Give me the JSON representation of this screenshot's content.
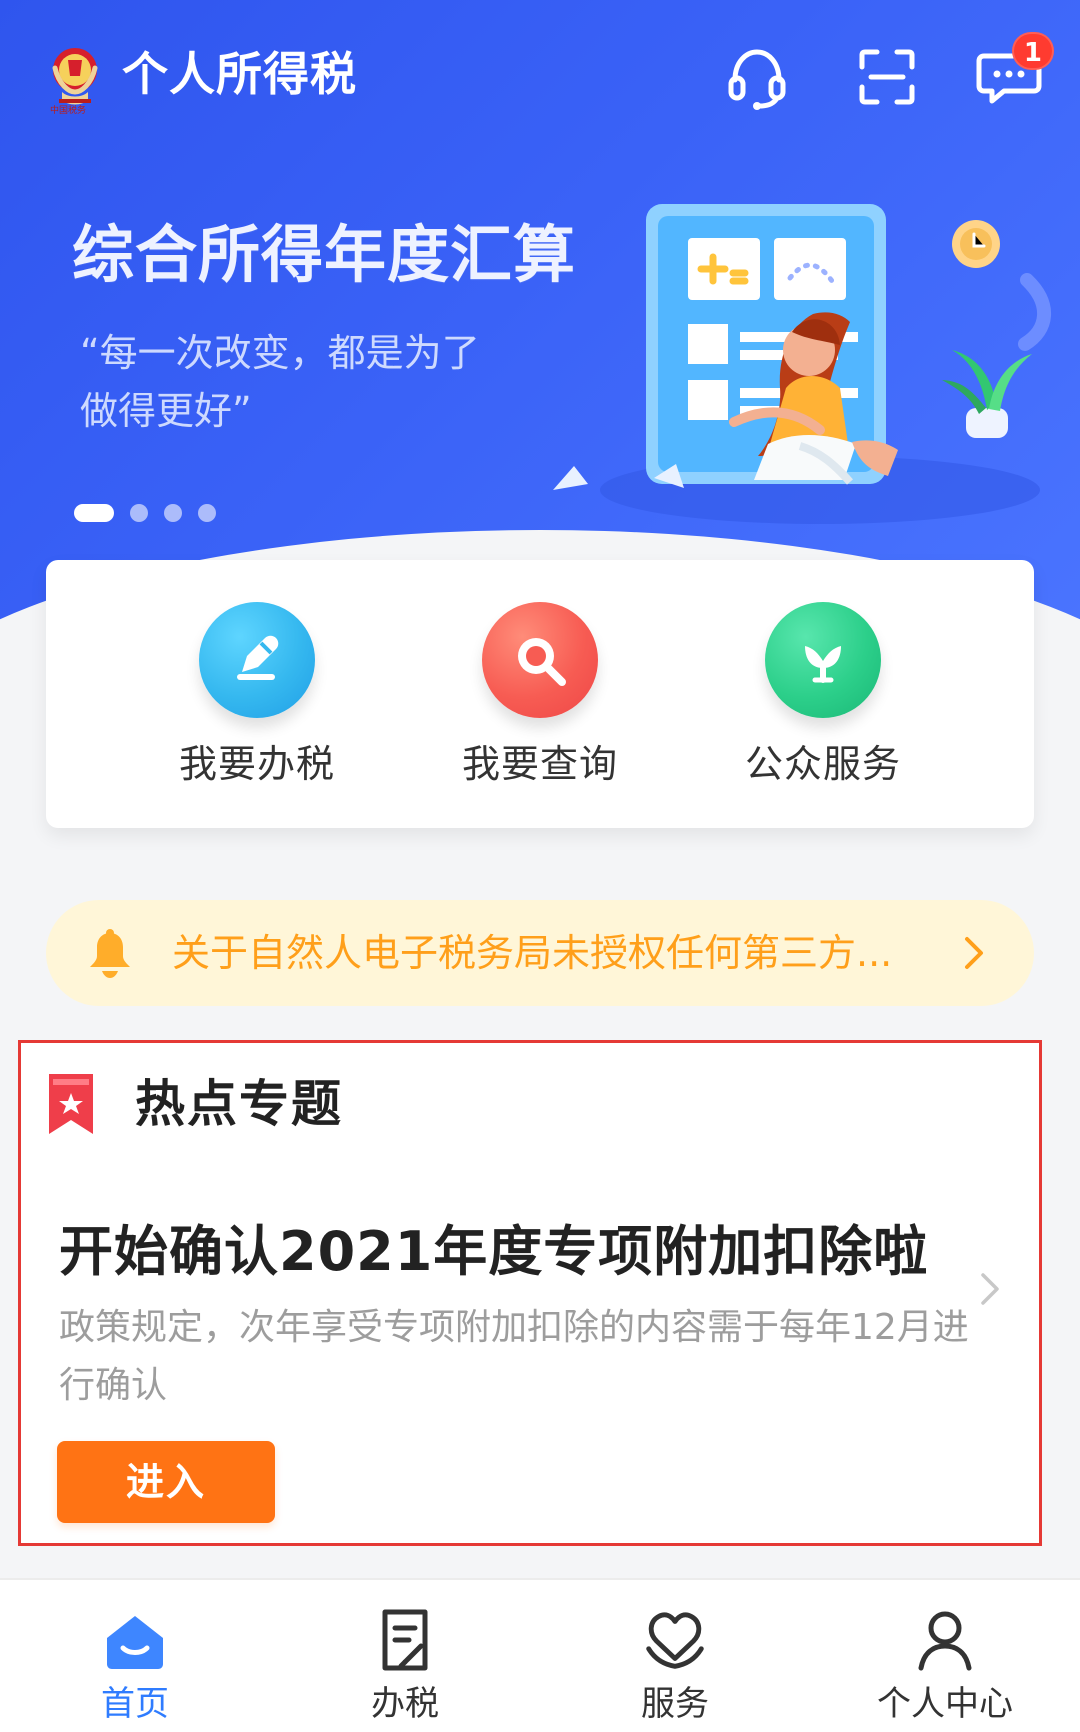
{
  "header": {
    "title": "个人所得税",
    "message_badge": "1"
  },
  "banner": {
    "headline": "综合所得年度汇算",
    "quote_line_1": "“每一次改变，都是为了",
    "quote_line_2": "做得更好”",
    "dots": 4,
    "active_dot": 0
  },
  "quick_actions": [
    {
      "label": "我要办税",
      "color": "#35b8ef"
    },
    {
      "label": "我要查询",
      "color": "#f75c53"
    },
    {
      "label": "公众服务",
      "color": "#2ccf8a"
    }
  ],
  "notice": {
    "text": "关于自然人电子税务局未授权任何第三方..."
  },
  "hot_topic": {
    "section_title": "热点专题",
    "title": "开始确认2021年度专项附加扣除啦",
    "description": "政策规定，次年享受专项附加扣除的内容需于每年12月进行确认",
    "button_label": "进入"
  },
  "bottom_nav": [
    {
      "label": "首页",
      "icon": "home-icon",
      "active": true
    },
    {
      "label": "办税",
      "icon": "document-icon",
      "active": false
    },
    {
      "label": "服务",
      "icon": "service-icon",
      "active": false
    },
    {
      "label": "个人中心",
      "icon": "profile-icon",
      "active": false
    }
  ],
  "icons": {
    "header": [
      "emblem-icon",
      "headset-icon",
      "scan-icon",
      "message-icon"
    ],
    "notice": [
      "bell-icon",
      "chevron-right-icon"
    ],
    "hot_topic": [
      "bookmark-icon",
      "chevron-right-icon"
    ]
  },
  "colors": {
    "hero_blue": "#3a62f7",
    "active_nav": "#2f7cff",
    "notice_text": "#ff9f1a",
    "enter_button": "#ff7314",
    "highlight_border": "#e53935"
  }
}
